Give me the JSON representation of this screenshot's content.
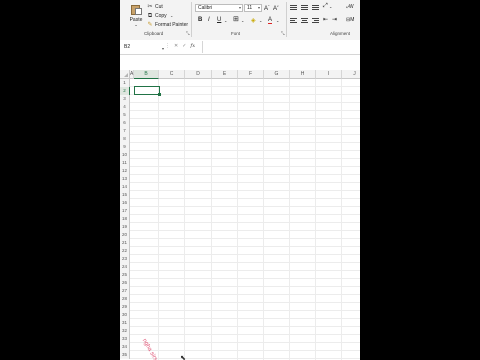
{
  "ribbon": {
    "clipboard": {
      "paste_label": "Paste",
      "cut_label": "Cut",
      "copy_label": "Copy",
      "format_painter_label": "Format Painter",
      "group_label": "Clipboard"
    },
    "font": {
      "family": "Calibri",
      "size": "11",
      "group_label": "Font"
    },
    "alignment": {
      "group_label": "Alignment",
      "wrap_partial": "W",
      "merge_partial": "M"
    }
  },
  "formula_bar": {
    "name_box": "B2",
    "fx_label": "fx",
    "value": ""
  },
  "grid": {
    "columns": [
      "A",
      "B",
      "C",
      "D",
      "E",
      "F",
      "G",
      "H",
      "I",
      "J"
    ],
    "rows": [
      "1",
      "2",
      "3",
      "4",
      "5",
      "6",
      "7",
      "8",
      "9",
      "10",
      "11",
      "12",
      "13",
      "14",
      "15",
      "16",
      "17",
      "18",
      "19",
      "20",
      "21",
      "22",
      "23",
      "24",
      "25",
      "26",
      "27",
      "28",
      "29",
      "30",
      "31",
      "32",
      "33",
      "34",
      "35"
    ],
    "active_cell": "B2"
  },
  "colors": {
    "accent": "#217346",
    "watermark": "#e05a7a"
  },
  "watermark_text": "ngha sirs"
}
